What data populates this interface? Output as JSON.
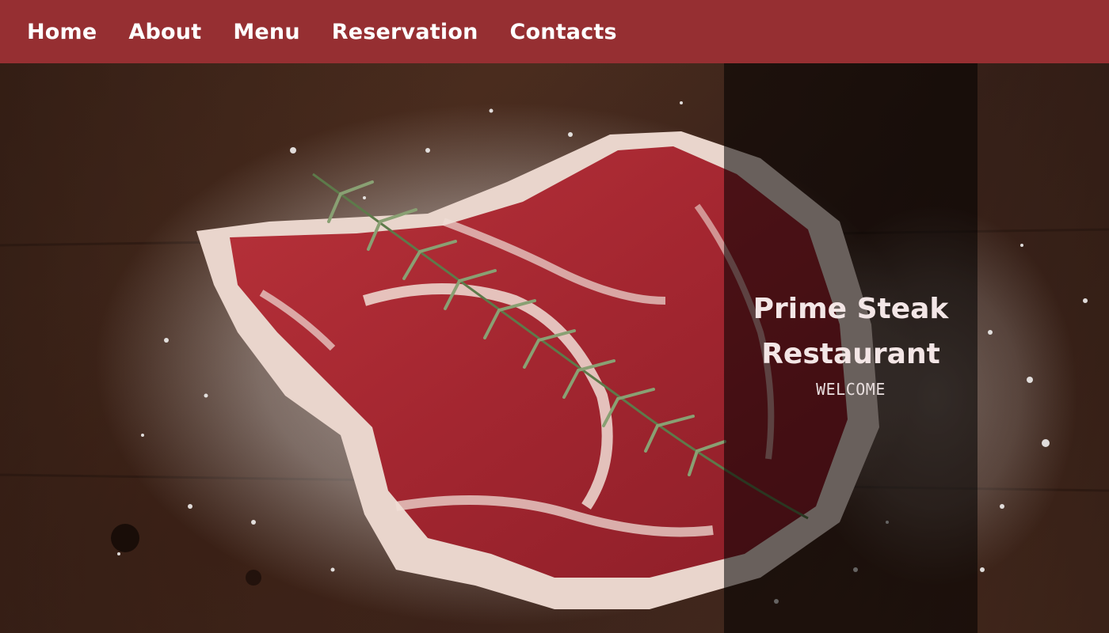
{
  "nav": {
    "items": [
      {
        "label": "Home"
      },
      {
        "label": "About"
      },
      {
        "label": "Menu"
      },
      {
        "label": "Reservation"
      },
      {
        "label": "Contacts"
      }
    ]
  },
  "hero": {
    "title": "Prime Steak Restaurant",
    "subtitle": "WELCOME"
  },
  "colors": {
    "navbar": "#962f32",
    "overlay": "rgba(0,0,0,0.55)",
    "text": "#ffffff"
  },
  "icons": {
    "hero_image": "steak-photo"
  }
}
